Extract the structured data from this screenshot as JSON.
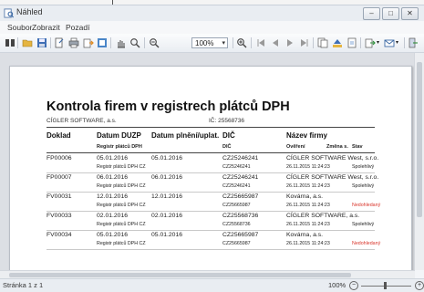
{
  "window": {
    "title": "Náhled"
  },
  "menu": [
    "Soubor",
    "Zobrazit",
    "Pozadí"
  ],
  "toolbar": {
    "zoom_value": "100%"
  },
  "report": {
    "title": "Kontrola firem v registrech plátců DPH",
    "company": "CÍGLER SOFTWARE, a.s.",
    "ic": "IČ: 25568736",
    "headers": {
      "doklad": "Doklad",
      "datum_duzp": "Datum DUZP",
      "datum_plneni": "Datum plnění/uplat.",
      "dic": "DIČ",
      "nazev": "Název firmy"
    },
    "subheaders": {
      "registr": "Registr plátců DPH",
      "dic": "DIČ",
      "overeni": "Ověření",
      "zmena": "Změna s.",
      "stav": "Stav"
    },
    "rows": [
      {
        "doklad": "FP00006",
        "duzp": "05.01.2016",
        "plneni": "05.01.2016",
        "dic": "CZ25246241",
        "nazev": "CÍGLER SOFTWARE West, s.r.o.",
        "registr": "Registr plátců DPH CZ",
        "dic2": "CZ25246241",
        "overeni": "26.11.2015 11:24:23",
        "stav": "Spolehlivý",
        "stav_color": "#222222"
      },
      {
        "doklad": "FP00007",
        "duzp": "06.01.2016",
        "plneni": "06.01.2016",
        "dic": "CZ25246241",
        "nazev": "CÍGLER SOFTWARE West, s.r.o.",
        "registr": "Registr plátců DPH CZ",
        "dic2": "CZ25246241",
        "overeni": "26.11.2015 11:24:23",
        "stav": "Spolehlivý",
        "stav_color": "#222222"
      },
      {
        "doklad": "FV00031",
        "duzp": "12.01.2016",
        "plneni": "12.01.2016",
        "dic": "CZ25665987",
        "nazev": "Kovárna, a.s.",
        "registr": "Registr plátců DPH CZ",
        "dic2": "CZ25665987",
        "overeni": "26.11.2015 11:24:23",
        "stav": "Nedohledaný",
        "stav_color": "#d9352b"
      },
      {
        "doklad": "FV00033",
        "duzp": "02.01.2016",
        "plneni": "02.01.2016",
        "dic": "CZ25568736",
        "nazev": "CÍGLER SOFTWARE, a.s.",
        "registr": "Registr plátců DPH CZ",
        "dic2": "CZ25568736",
        "overeni": "26.11.2015 11:24:23",
        "stav": "Spolehlivý",
        "stav_color": "#222222"
      },
      {
        "doklad": "FV00034",
        "duzp": "05.01.2016",
        "plneni": "05.01.2016",
        "dic": "CZ25665987",
        "nazev": "Kovárna, a.s.",
        "registr": "Registr plátců DPH CZ",
        "dic2": "CZ25665987",
        "overeni": "26.11.2015 11:24:23",
        "stav": "Nedohledaný",
        "stav_color": "#d9352b"
      }
    ]
  },
  "status": {
    "page": "Stránka 1 z 1",
    "zoom": "100%"
  }
}
